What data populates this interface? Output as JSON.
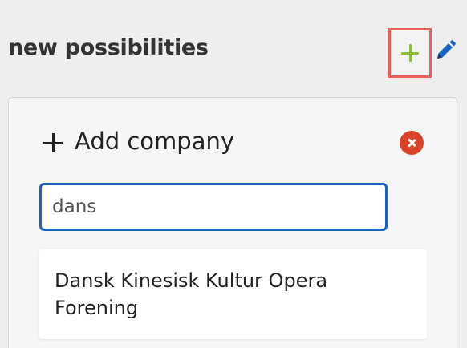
{
  "section": {
    "title": "new possibilities",
    "add_icon": "plus-icon",
    "add_icon_color": "#8bbf3a",
    "highlight_color": "#e9605a",
    "edit_icon": "pencil-icon",
    "edit_icon_color": "#1a63c0"
  },
  "panel": {
    "title": "Add company",
    "title_icon": "plus-icon",
    "close_icon": "close-icon",
    "close_color": "#d9432a"
  },
  "search": {
    "value": "dans",
    "border_color": "#1a63c0"
  },
  "results": [
    {
      "name": "Dansk Kinesisk Kultur Opera Forening"
    }
  ]
}
